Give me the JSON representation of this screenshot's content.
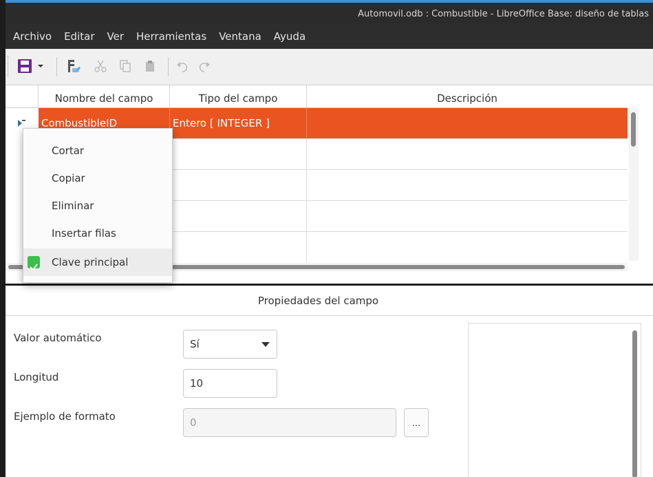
{
  "window": {
    "title": "Automovil.odb : Combustible - LibreOffice Base: diseño de tablas"
  },
  "menu": [
    "Archivo",
    "Editar",
    "Ver",
    "Herramientas",
    "Ventana",
    "Ayuda"
  ],
  "toolbar": {
    "icons": [
      "save-icon",
      "dropdown-arrow-icon",
      "primary-key-icon",
      "cut-icon",
      "copy-icon",
      "paste-icon",
      "undo-icon",
      "redo-icon"
    ]
  },
  "table": {
    "columns": [
      "Nombre del campo",
      "Tipo del campo",
      "Descripción"
    ],
    "rows": [
      {
        "name": "CombustibleID",
        "type": "Entero [ INTEGER ]",
        "description": "",
        "selected": true
      },
      {
        "name": "",
        "type": "",
        "description": ""
      },
      {
        "name": "",
        "type": "",
        "description": ""
      },
      {
        "name": "",
        "type": "",
        "description": ""
      },
      {
        "name": "",
        "type": "",
        "description": ""
      }
    ]
  },
  "context_menu": {
    "items": [
      "Cortar",
      "Copiar",
      "Eliminar",
      "Insertar filas",
      "Clave principal"
    ],
    "checked_item": "Clave principal"
  },
  "properties": {
    "title": "Propiedades del campo",
    "auto_value_label": "Valor automático",
    "auto_value": "Sí",
    "length_label": "Longitud",
    "length_value": "10",
    "format_label": "Ejemplo de formato",
    "format_value": "0",
    "format_button": "..."
  },
  "colors": {
    "accent": "#e95420",
    "check": "#3cbf4c",
    "save_icon": "#6a2a8a",
    "titlebar": "#2b2b2b"
  }
}
